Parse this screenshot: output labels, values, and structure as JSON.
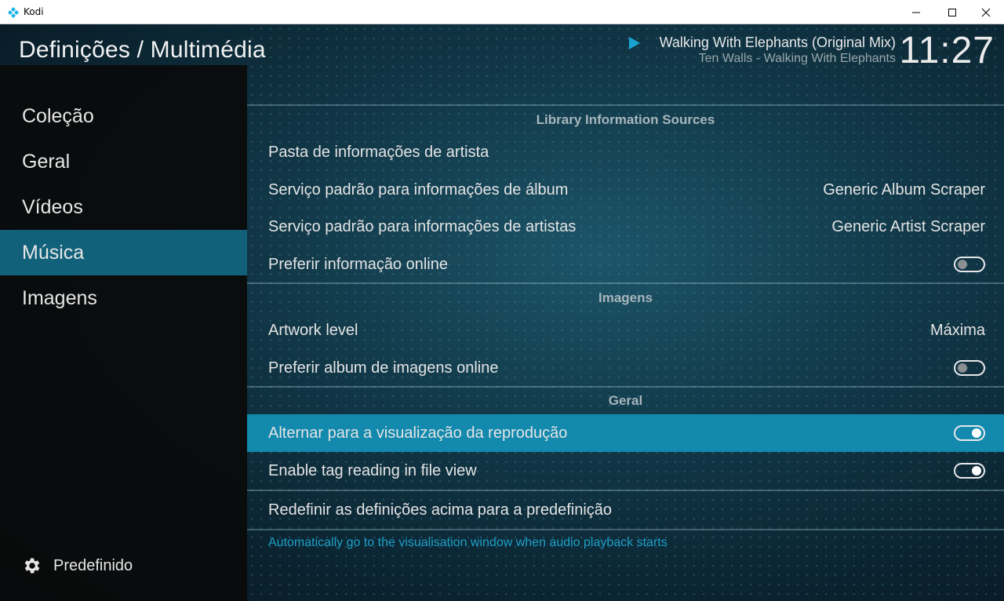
{
  "window": {
    "title": "Kodi"
  },
  "header": {
    "title": "Definições / Multimédia",
    "now_playing_title": "Walking With Elephants (Original Mix)",
    "now_playing_artist": "Ten Walls - Walking With Elephants",
    "clock": "11:27"
  },
  "sidebar": {
    "items": [
      {
        "label": "Coleção"
      },
      {
        "label": "Geral"
      },
      {
        "label": "Vídeos"
      },
      {
        "label": "Música",
        "active": true
      },
      {
        "label": "Imagens"
      }
    ],
    "default_label": "Predefinido"
  },
  "settings": {
    "sections": {
      "library": "Library Information Sources",
      "images": "Imagens",
      "general": "Geral"
    },
    "rows": {
      "artist_folder": {
        "label": "Pasta de informações de artista"
      },
      "album_scraper": {
        "label": "Serviço padrão para informações de álbum",
        "value": "Generic Album Scraper"
      },
      "artist_scraper": {
        "label": "Serviço padrão para informações de artistas",
        "value": "Generic Artist Scraper"
      },
      "prefer_online": {
        "label": "Preferir informação online",
        "value": false
      },
      "artwork_level": {
        "label": "Artwork level",
        "value": "Máxima"
      },
      "prefer_online_art": {
        "label": "Preferir album de imagens online",
        "value": false
      },
      "switch_visualisation": {
        "label": "Alternar para a visualização da reprodução",
        "value": true
      },
      "tag_reading": {
        "label": "Enable tag reading in file view",
        "value": true
      },
      "reset": {
        "label": "Redefinir as definições acima para a predefinição"
      }
    },
    "description": "Automatically go to the visualisation window when audio playback starts"
  }
}
